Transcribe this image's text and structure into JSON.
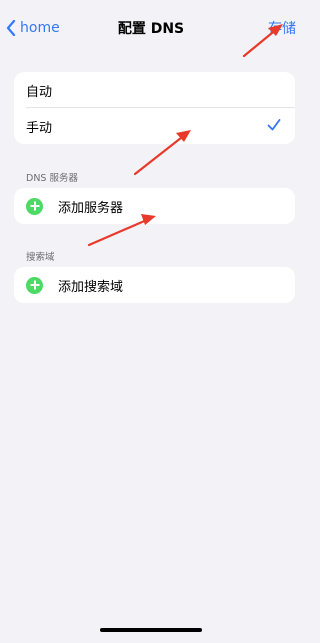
{
  "nav": {
    "back_label": "home",
    "title": "配置 DNS",
    "save_label": "存储"
  },
  "mode_group": {
    "items": [
      {
        "label": "自动",
        "selected": false
      },
      {
        "label": "手动",
        "selected": true
      }
    ]
  },
  "dns_servers": {
    "header": "DNS 服务器",
    "add_label": "添加服务器"
  },
  "search_domains": {
    "header": "搜索域",
    "add_label": "添加搜索域"
  },
  "colors": {
    "accent": "#3478f6",
    "add_green": "#4cd964",
    "annotation_red": "#e8392b",
    "background": "#f2f2f7"
  }
}
